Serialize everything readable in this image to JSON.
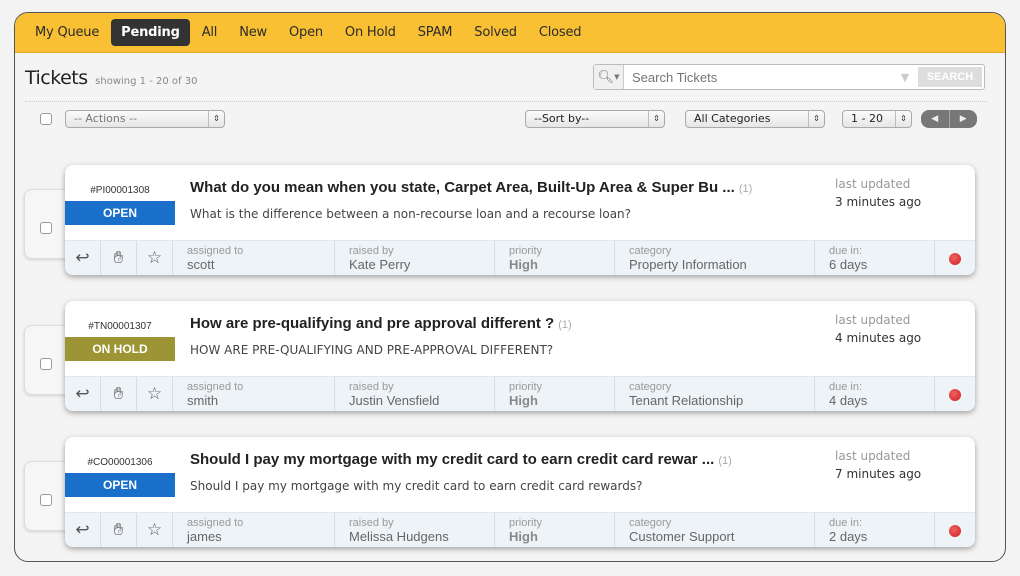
{
  "nav": {
    "tabs": [
      {
        "label": "My Queue",
        "active": false
      },
      {
        "label": "Pending",
        "active": true
      },
      {
        "label": "All",
        "active": false
      },
      {
        "label": "New",
        "active": false
      },
      {
        "label": "Open",
        "active": false
      },
      {
        "label": "On Hold",
        "active": false
      },
      {
        "label": "SPAM",
        "active": false
      },
      {
        "label": "Solved",
        "active": false
      },
      {
        "label": "Closed",
        "active": false
      }
    ]
  },
  "header": {
    "title": "Tickets",
    "showing": "showing 1 - 20 of 30",
    "search_placeholder": "Search Tickets",
    "search_button": "SEARCH"
  },
  "toolbar": {
    "actions": "-- Actions --",
    "sort": "--Sort by--",
    "category": "All Categories",
    "range": "1 - 20"
  },
  "labels": {
    "last_updated": "last updated",
    "assigned_to": "assigned to",
    "raised_by": "raised by",
    "priority": "priority",
    "category": "category",
    "due_in": "due in:"
  },
  "colors": {
    "open": "#1a6fc9",
    "on_hold": "#9c9435",
    "accent": "#f8c032"
  },
  "tickets": [
    {
      "id": "#PI00001308",
      "status": "OPEN",
      "subject": "What do you mean when you state, Carpet Area, Built-Up Area & Super Bu ...",
      "count": "(1)",
      "description": "What is the difference between a non-recourse loan and a recourse loan?",
      "updated": "3 minutes ago",
      "assigned_to": "scott",
      "raised_by": "Kate Perry",
      "priority": "High",
      "category": "Property Information",
      "due_in": "6 days"
    },
    {
      "id": "#TN00001307",
      "status": "ON HOLD",
      "subject": "How are pre-qualifying and pre approval different ?",
      "count": "(1)",
      "description": "HOW ARE PRE-QUALIFYING AND PRE-APPROVAL DIFFERENT?",
      "updated": "4 minutes ago",
      "assigned_to": "smith",
      "raised_by": "Justin Vensfield",
      "priority": "High",
      "category": "Tenant Relationship",
      "due_in": "4 days"
    },
    {
      "id": "#CO00001306",
      "status": "OPEN",
      "subject": "Should I pay my mortgage with my credit card to earn credit card rewar ...",
      "count": "(1)",
      "description": "Should I pay my mortgage with my credit card to earn credit card rewards?",
      "updated": "7 minutes ago",
      "assigned_to": "james",
      "raised_by": "Melissa Hudgens",
      "priority": "High",
      "category": "Customer Support",
      "due_in": "2 days"
    }
  ]
}
